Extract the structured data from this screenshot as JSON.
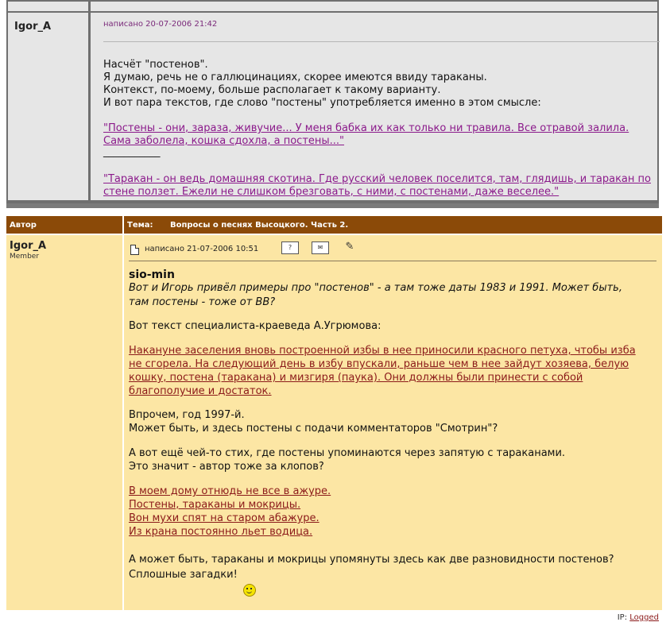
{
  "previous_post": {
    "author": "Igor_A",
    "posted": "написано 20-07-2006 21:42",
    "lines": [
      "Насчёт \"постенов\".",
      "Я думаю, речь не о галлюцинациях, скорее имеются ввиду тараканы.",
      "Контекст, по-моему, больше располагает к такому варианту.",
      "И вот пара текстов, где слово \"постены\" употребляется именно в этом смысле:"
    ],
    "quote1": [
      "\"Постены - они, зараза, живучие... У меня бабка их как только ни травила. Все отравой залила.",
      "Сама заболела, кошка сдохла, а постены...\""
    ],
    "separator": "___________",
    "quote2": [
      "\"Таракан - он ведь домашняя скотина. Где русский человек поселится, там, глядишь, и таракан по",
      "стене ползет. Ежели не слишком брезговать, с ними, с постенами, даже веселее.\""
    ]
  },
  "table_header": {
    "author_label": "Автор",
    "topic_label": "Тема:",
    "topic_value": "Вопросы о песнях Высоцкого. Часть 2."
  },
  "post": {
    "author": "Igor_A",
    "rank": "Member",
    "posted": "написано 21-07-2006 10:51",
    "quoted_user": "sio-min",
    "quote_lines": [
      "Вот и Игорь привёл примеры про \"постенов\" - а там тоже даты 1983 и 1991. Может быть,",
      "там постены - тоже от ВВ?"
    ],
    "intro": "Вот текст специалиста-краеведа А.Угрюмова:",
    "link_lines": [
      "Накануне заселения вновь построенной избы в нее приносили красного петуха, чтобы изба",
      "не сгорела. На следующий день в избу впускали, раньше чем в нее зайдут хозяева, белую",
      "кошку, постена (таракана) и мизгиря (паука). Они должны были принести с собой",
      "благополучие и достаток."
    ],
    "para2": [
      "Впрочем, год 1997-й.",
      "Может быть, и здесь постены с подачи комментаторов \"Смотрин\"?"
    ],
    "para3": [
      "А вот ещё чей-то стих, где постены упоминаются через запятую с тараканами.",
      "Это значит - автор тоже за клопов?"
    ],
    "poem": [
      "В моем дому отнюдь не все в ажуре.",
      "Постены, тараканы и мокрицы.",
      "Вон мухи спят на старом абажуре.",
      "Из крана постоянно льет водица."
    ],
    "closing": [
      "А может быть, тараканы и мокрицы упомянуты здесь как две разновидности постенов?",
      "Сплошные загадки!"
    ],
    "ip_label": "IP:",
    "ip_value": "Logged"
  }
}
